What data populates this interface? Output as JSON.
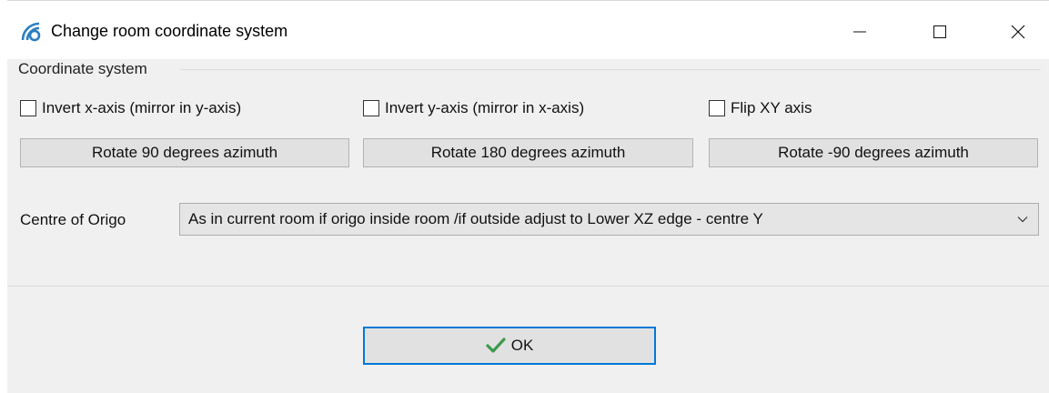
{
  "window": {
    "title": "Change room coordinate system",
    "icon": "signal-wave-icon",
    "controls": [
      "minimize-icon",
      "maximize-icon",
      "close-icon"
    ]
  },
  "group": {
    "label": "Coordinate system"
  },
  "checkboxes": [
    {
      "label": "Invert x-axis (mirror in y-axis)",
      "checked": false
    },
    {
      "label": "Invert y-axis (mirror in x-axis)",
      "checked": false
    },
    {
      "label": "Flip XY axis",
      "checked": false
    }
  ],
  "rotate_buttons": [
    {
      "label": "Rotate 90 degrees azimuth"
    },
    {
      "label": "Rotate 180 degrees azimuth"
    },
    {
      "label": "Rotate -90 degrees azimuth"
    }
  ],
  "origo": {
    "label": "Centre of Origo",
    "selected": "As in current room if origo inside room /if outside adjust to Lower XZ edge - centre Y"
  },
  "ok_button": {
    "label": "OK",
    "icon": "checkmark-icon"
  },
  "colors": {
    "focus_border": "#0078d7",
    "checkmark": "#3a9a4a",
    "icon_blue": "#2a7fc1"
  }
}
